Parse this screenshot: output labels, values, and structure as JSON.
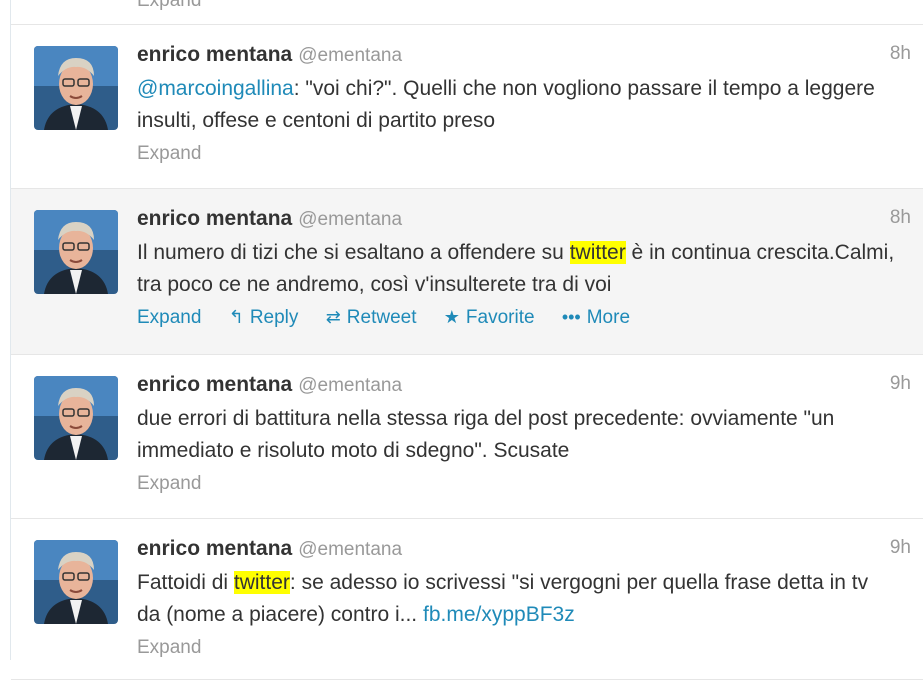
{
  "top_fragment": {
    "label": "Expand"
  },
  "tweets": [
    {
      "fullname": "enrico mentana",
      "username": "@ementana",
      "time": "8h",
      "mention": "@marcoingallina",
      "text_rest": ":  \"voi chi?\". Quelli che non vogliono passare il tempo a leggere insulti, offese e centoni di partito preso",
      "expand": "Expand"
    },
    {
      "fullname": "enrico mentana",
      "username": "@ementana",
      "time": "8h",
      "text_before": "Il numero di tizi che si esaltano a offendere su ",
      "highlight": "twitter",
      "text_after": " è in continua crescita.Calmi, tra poco ce ne andremo, così v'insulterete tra di voi",
      "expand": "Expand",
      "actions": {
        "reply": "Reply",
        "retweet": "Retweet",
        "favorite": "Favorite",
        "more": "More"
      }
    },
    {
      "fullname": "enrico mentana",
      "username": "@ementana",
      "time": "9h",
      "text": "due errori di battitura nella stessa riga del post precedente: ovviamente \"un immediato e risoluto moto di sdegno\". Scusate",
      "expand": "Expand"
    },
    {
      "fullname": "enrico mentana",
      "username": "@ementana",
      "time": "9h",
      "text_before": "Fattoidi di ",
      "highlight": "twitter",
      "text_after": ": se adesso io scrivessi \"si vergogni per quella frase detta in tv da (nome a piacere) contro i... ",
      "link": "fb.me/xyppBF3z",
      "expand": "Expand"
    }
  ],
  "icons": {
    "reply": "reply-arrow-icon",
    "retweet": "retweet-icon",
    "favorite": "star-icon",
    "more": "more-dots-icon"
  },
  "colors": {
    "link": "#1f8ab8",
    "muted": "#999999",
    "text": "#333333",
    "highlight": "#ffff00",
    "hover_bg": "#f5f5f5"
  }
}
